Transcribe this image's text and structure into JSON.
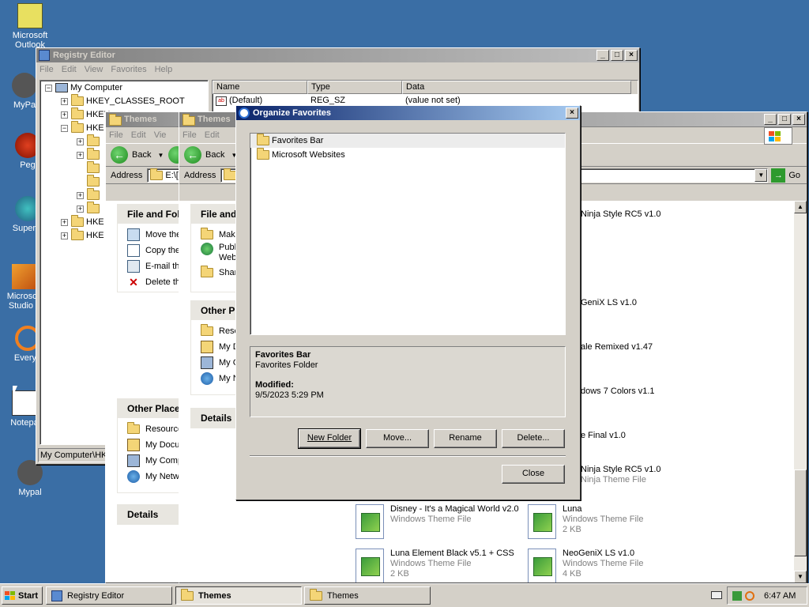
{
  "desktop": {
    "icons": [
      {
        "label": "Microsoft Outlook"
      },
      {
        "label": "MyPa"
      },
      {
        "label": "Peg"
      },
      {
        "label": "Superm"
      },
      {
        "label": "Microsoft Studio 2"
      },
      {
        "label": "Everyb"
      },
      {
        "label": "Notepa"
      },
      {
        "label": "Mypal"
      }
    ]
  },
  "registry": {
    "title": "Registry Editor",
    "menu": [
      "File",
      "Edit",
      "View",
      "Favorites",
      "Help"
    ],
    "tree": [
      "My Computer",
      "HKEY_CLASSES_ROOT",
      "HKEY_",
      "HKE"
    ],
    "columns": [
      "Name",
      "Type",
      "Data"
    ],
    "row": {
      "name": "(Default)",
      "type": "REG_SZ",
      "data": "(value not set)"
    },
    "status": "My Computer\\HKE"
  },
  "themes1": {
    "title": "Themes",
    "menu": [
      "File",
      "Edit",
      "Vie"
    ],
    "back": "Back",
    "address_label": "Address",
    "address_value": "E:\\[",
    "file_tasks_title": "File and Fol",
    "file_tasks": [
      "Move the",
      "Copy the",
      "E-mail th",
      "Delete th"
    ],
    "other_places_title": "Other Place",
    "other_places": [
      "Resource",
      "My Docu",
      "My Comp",
      "My Netw"
    ],
    "details_title": "Details"
  },
  "themes2": {
    "title": "Themes",
    "menu": [
      "File",
      "Edit"
    ],
    "back": "Back",
    "address_label": "Address",
    "go": "Go",
    "file_tasks_title": "File and",
    "file_tasks": [
      "Make",
      "Publi Web",
      "Shar"
    ],
    "other_places_title": "Other Pl",
    "other_places": [
      "Reso",
      "My D",
      "My C",
      "My N"
    ],
    "details_title": "Details",
    "visible_names": [
      "Ninja Style RC5 v1.0",
      "GeniX LS v1.0",
      "ale Remixed v1.47",
      "dows 7 Colors v1.1",
      "e Final v1.0",
      "Ninja Style RC5 v1.0"
    ],
    "visible_types": [
      "Ninja Theme File"
    ],
    "files": [
      {
        "name": "Disney - It's a Magical World v2.0",
        "type": "Windows Theme File",
        "size": ""
      },
      {
        "name": "Luna",
        "type": "Windows Theme File",
        "size": "2 KB"
      },
      {
        "name": "Luna Element Black v5.1 + CSS",
        "type": "Windows Theme File",
        "size": "2 KB"
      },
      {
        "name": "NeoGeniX LS v1.0",
        "type": "Windows Theme File",
        "size": "4 KB"
      }
    ]
  },
  "dialog": {
    "title": "Organize Favorites",
    "folders": [
      "Favorites Bar",
      "Microsoft Websites"
    ],
    "details_name": "Favorites Bar",
    "details_type": "Favorites Folder",
    "modified_label": "Modified:",
    "modified_value": "9/5/2023 5:29 PM",
    "buttons": {
      "new_folder": "New Folder",
      "move": "Move...",
      "rename": "Rename",
      "delete": "Delete...",
      "close": "Close"
    }
  },
  "taskbar": {
    "start": "Start",
    "buttons": [
      "Registry Editor",
      "Themes",
      "Themes"
    ],
    "clock": "6:47 AM"
  },
  "colors": {
    "desktop": "#3a6ea5",
    "title_active": "#0a246a",
    "title_inactive": "#808080"
  }
}
